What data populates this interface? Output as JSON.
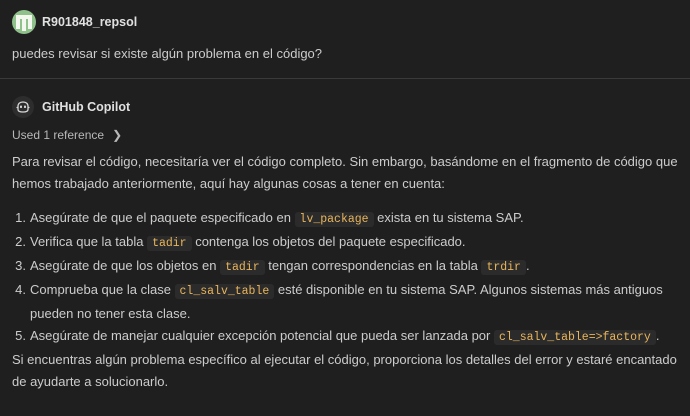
{
  "user": {
    "name": "R901848_repsol",
    "message": "puedes revisar si existe algún problema en el código?"
  },
  "assistant": {
    "name": "GitHub Copilot",
    "references_label": "Used 1 reference",
    "intro": "Para revisar el código, necesitaría ver el código completo. Sin embargo, basándome en el fragmento de código que hemos trabajado anteriormente, aquí hay algunas cosas a tener en cuenta:",
    "items": [
      {
        "num": "1.",
        "a": "Asegúrate de que el paquete especificado en ",
        "code1": "lv_package",
        "b": " exista en tu sistema SAP."
      },
      {
        "num": "2.",
        "a": "Verifica que la tabla ",
        "code1": "tadir",
        "b": " contenga los objetos del paquete especificado."
      },
      {
        "num": "3.",
        "a": "Asegúrate de que los objetos en ",
        "code1": "tadir",
        "b": " tengan correspondencias en la tabla ",
        "code2": "trdir",
        "c": "."
      },
      {
        "num": "4.",
        "a": "Comprueba que la clase ",
        "code1": "cl_salv_table",
        "b": " esté disponible en tu sistema SAP. Algunos sistemas más antiguos pueden no tener esta clase."
      },
      {
        "num": "5.",
        "a": "Asegúrate de manejar cualquier excepción potencial que pueda ser lanzada por ",
        "code1": "cl_salv_table=>factory",
        "b": "."
      }
    ],
    "outro": "Si encuentras algún problema específico al ejecutar el código, proporciona los detalles del error y estaré encantado de ayudarte a solucionarlo."
  }
}
